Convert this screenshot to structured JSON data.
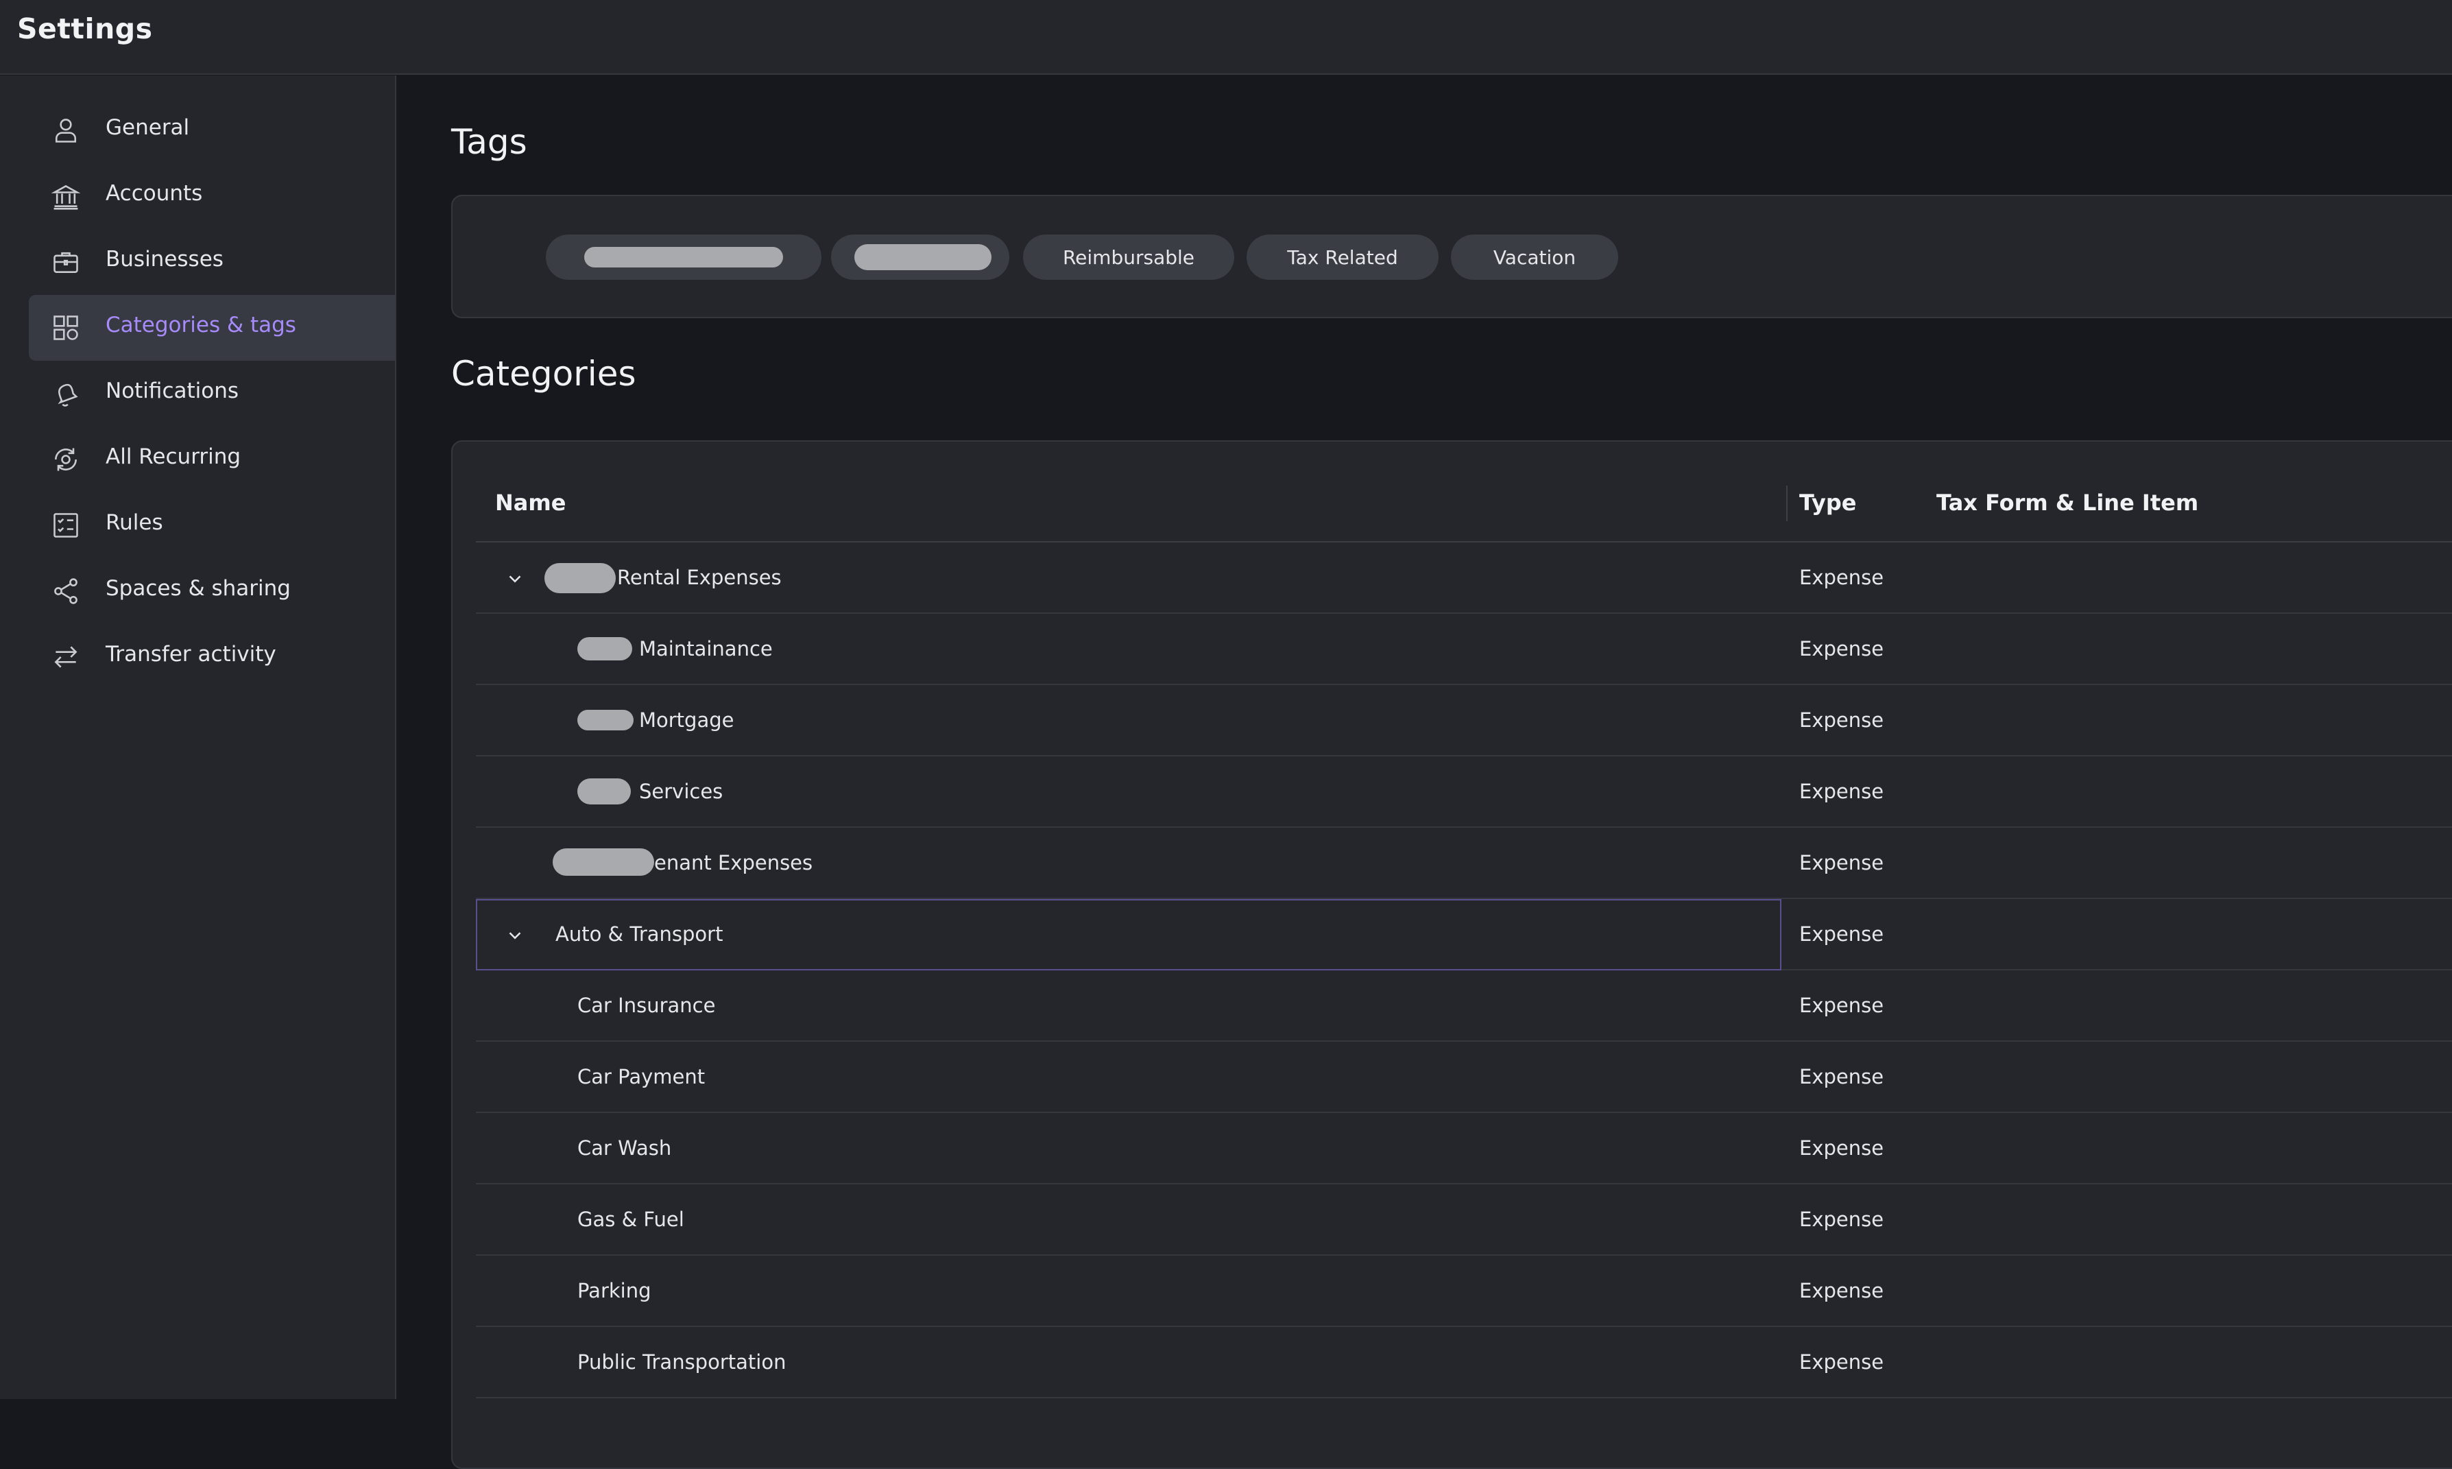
{
  "app": {
    "title": "Settings"
  },
  "sidebar": {
    "items": [
      {
        "label": "General",
        "icon": "user-icon",
        "active": false
      },
      {
        "label": "Accounts",
        "icon": "bank-icon",
        "active": false
      },
      {
        "label": "Businesses",
        "icon": "briefcase-icon",
        "active": false
      },
      {
        "label": "Categories & tags",
        "icon": "grid-icon",
        "active": true
      },
      {
        "label": "Notifications",
        "icon": "bell-icon",
        "active": false
      },
      {
        "label": "All Recurring",
        "icon": "recurring-icon",
        "active": false
      },
      {
        "label": "Rules",
        "icon": "checklist-icon",
        "active": false
      },
      {
        "label": "Spaces & sharing",
        "icon": "share-icon",
        "active": false
      },
      {
        "label": "Transfer activity",
        "icon": "transfer-icon",
        "active": false
      }
    ]
  },
  "tags": {
    "heading": "Tags",
    "items": [
      "Reimbursable",
      "Tax Related",
      "Vacation"
    ]
  },
  "categories": {
    "heading": "Categories",
    "columns": {
      "name": "Name",
      "type": "Type",
      "tax": "Tax Form & Line Item"
    },
    "rows": [
      {
        "name": "Rental Expenses",
        "type": "Expense"
      },
      {
        "name": "Maintainance",
        "type": "Expense"
      },
      {
        "name": "Mortgage",
        "type": "Expense"
      },
      {
        "name": "Services",
        "type": "Expense"
      },
      {
        "name": "enant Expenses",
        "type": "Expense"
      },
      {
        "name": "Auto & Transport",
        "type": "Expense"
      },
      {
        "name": "Car Insurance",
        "type": "Expense"
      },
      {
        "name": "Car Payment",
        "type": "Expense"
      },
      {
        "name": "Car Wash",
        "type": "Expense"
      },
      {
        "name": "Gas & Fuel",
        "type": "Expense"
      },
      {
        "name": "Parking",
        "type": "Expense"
      },
      {
        "name": "Public Transportation",
        "type": "Expense"
      }
    ]
  },
  "colors": {
    "accent": "#a78bfa",
    "background": "#16181d",
    "panel": "#24262b"
  }
}
